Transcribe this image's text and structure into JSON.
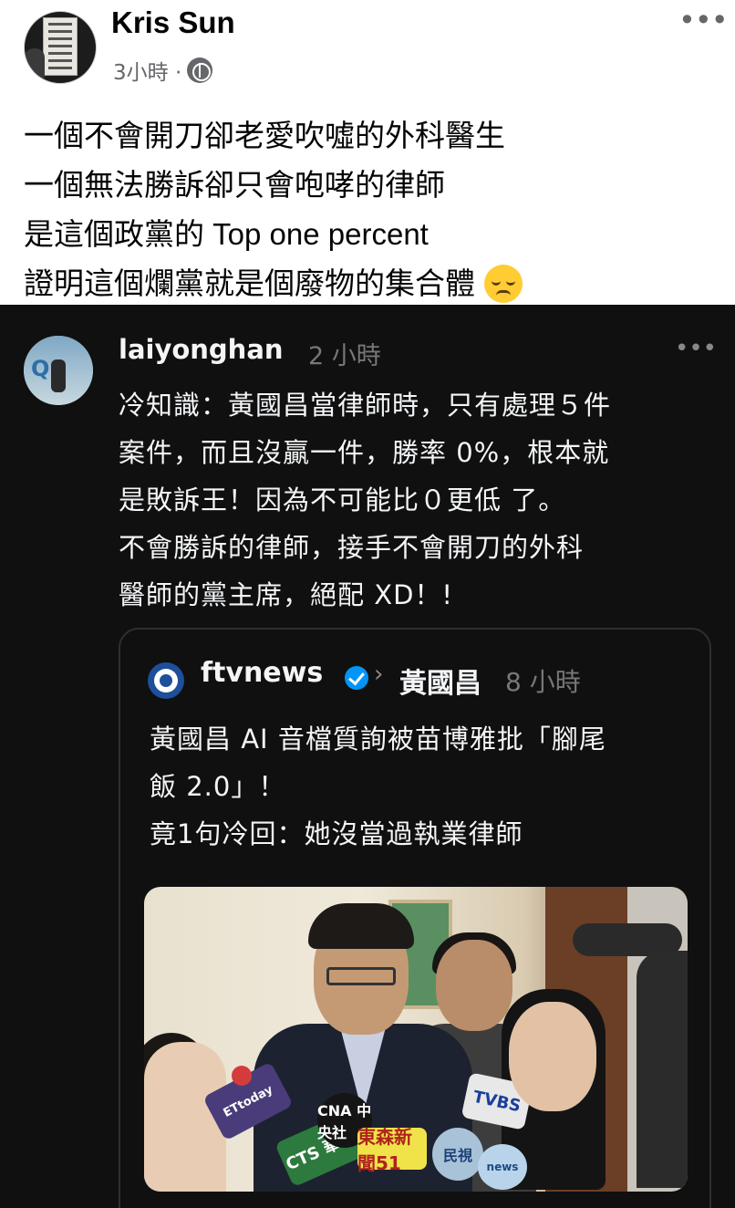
{
  "post": {
    "author": "Kris Sun",
    "time": "3小時 ·",
    "more": "•••",
    "lines": [
      "一個不會開刀卻老愛吹噓的外科醫生",
      "一個無法勝訴卻只會咆哮的律師",
      "是這個政黨的 Top one percent",
      "證明這個爛黨就是個廢物的集合體"
    ],
    "emoji": "relieved-face-emoji"
  },
  "thread": {
    "username": "laiyonghan",
    "time": "2 小時",
    "more": "•••",
    "lines": [
      "冷知識：黃國昌當律師時，只有處理５件",
      "案件，而且沒贏一件，勝率 0%，根本就",
      "是敗訴王！因為不可能比０更低 了。",
      "不會勝訴的律師，接手不會開刀的外科",
      "醫師的黨主席，絕配 XD！!"
    ],
    "quote": {
      "source": "ftvnews",
      "chevron": "›",
      "topic": "黃國昌",
      "time": "8 小時",
      "lines": [
        "黃國昌 AI 音檔質詢被苗博雅批「腳尾",
        "飯 2.0」！",
        "竟1句冷回：她沒當過執業律師"
      ],
      "mic_labels": [
        "ETtoday",
        "CTS 華視",
        "CNA 中央社",
        "東森新聞51",
        "民視",
        "TVBS",
        "news"
      ]
    }
  },
  "colors": {
    "dark_bg": "#101010",
    "muted": "#65676b",
    "verified": "#0095f6"
  }
}
